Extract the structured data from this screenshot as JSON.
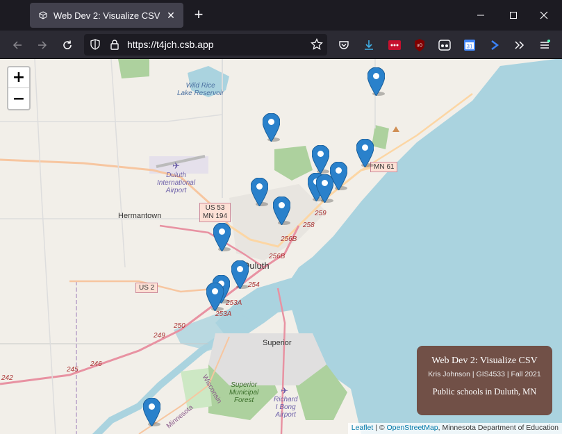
{
  "browser": {
    "tab_title": "Web Dev 2: Visualize CSV",
    "url": "https://t4jch.csb.app",
    "calendar_day": "31"
  },
  "map": {
    "zoom_in": "+",
    "zoom_out": "−",
    "labels": {
      "wild_rice": "Wild Rice\nLake Reservoir",
      "airport": "Duluth\nInternational\nAirport",
      "hermantown": "Hermantown",
      "duluth": "Duluth",
      "superior": "Superior",
      "superior_forest": "Superior\nMunicipal\nForest",
      "richard_bong": "Richard\nI Bong\nAirport",
      "wisconsin": "Wisconsin",
      "minnesota": "Minnesota"
    },
    "shields": {
      "us53": "US 53\nMN 194",
      "us2": "US 2",
      "mn61": "MN 61"
    },
    "exits": [
      "259",
      "258",
      "256B",
      "256B",
      "254",
      "253A",
      "253A",
      "250",
      "249",
      "246",
      "245",
      "242"
    ],
    "marker_count": 15
  },
  "infobox": {
    "title": "Web Dev 2: Visualize CSV",
    "subtitle": "Kris Johnson  |  GIS4533  |  Fall 2021",
    "description": "Public schools in Duluth, MN"
  },
  "attribution": {
    "leaflet": "Leaflet",
    "sep": " | © ",
    "osm": "OpenStreetMap",
    "rest": ", Minnesota Department of Education"
  }
}
